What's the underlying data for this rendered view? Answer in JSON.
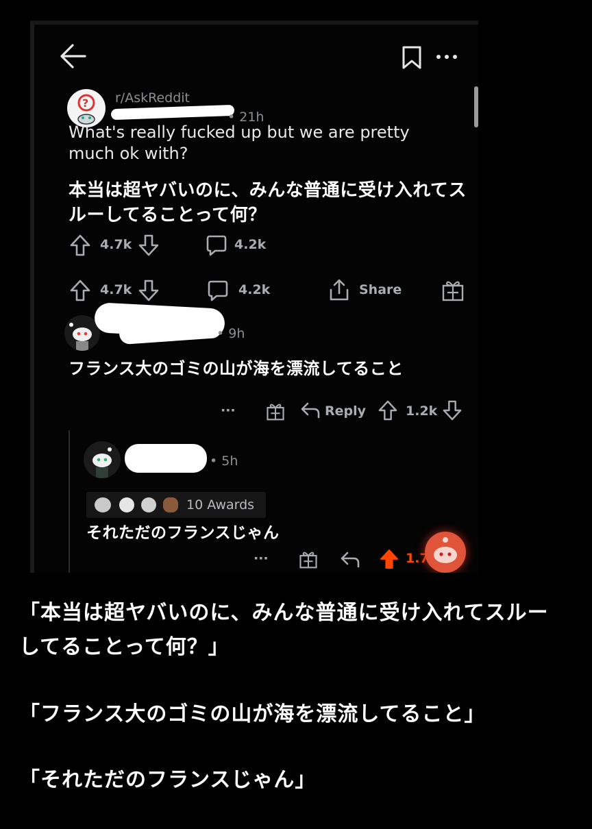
{
  "post": {
    "subreddit": "r/AskReddit",
    "age": "• 21h",
    "title_en": "What's really fucked up but we are pretty much ok with?",
    "title_ja": "本当は超ヤバいのに、みんな普通に受け入れてスルーしてることって何？",
    "upvotes_top": "4.7k",
    "comments_top": "4.2k",
    "upvotes": "4.7k",
    "comments": "4.2k",
    "share_label": "Share"
  },
  "comment1": {
    "age": "• 9h",
    "text": "フランス大のゴミの山が海を漂流してること",
    "more": "···",
    "reply_label": "Reply",
    "score": "1.2k"
  },
  "comment2": {
    "age": "• 5h",
    "awards_label": "10 Awards",
    "text": "それただのフランスじゃん",
    "more": "···",
    "score": "1.7"
  },
  "footer": {
    "line1": "「本当は超ヤバいのに、みんな普通に受け入れてスルー",
    "line2": "してることって何？」",
    "line3": "「フランス大のゴミの山が海を漂流してること」",
    "line4": "「それただのフランスじゃん」"
  },
  "colors": {
    "background": "#000000",
    "text": "#d7dadc",
    "upvote_active": "#ff4500"
  }
}
